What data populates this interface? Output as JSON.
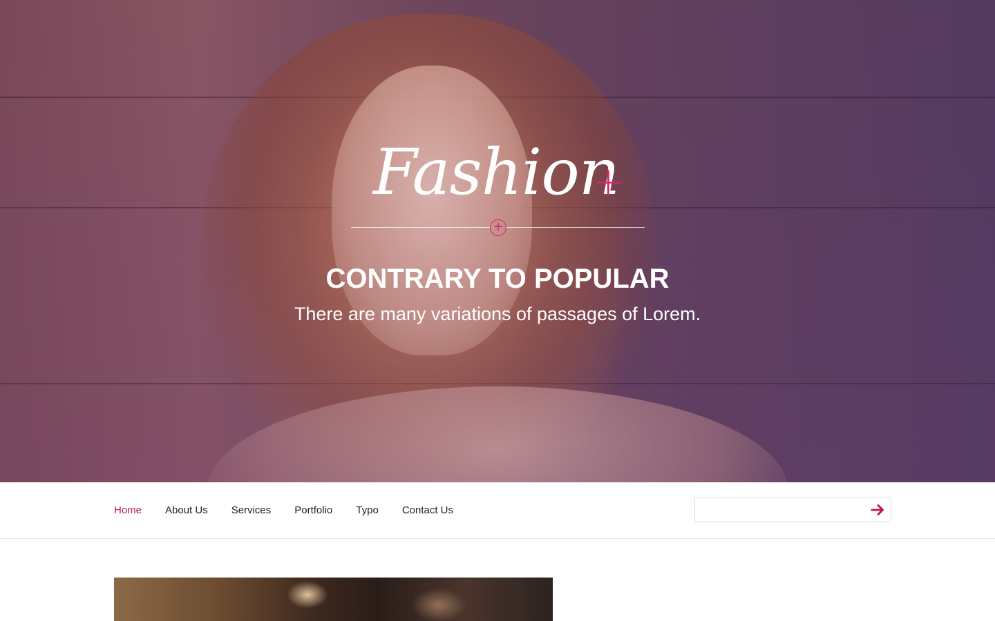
{
  "hero": {
    "logo_text": "Fashion",
    "logo_accent": "+",
    "divider_icon": "plus-circle-icon",
    "title": "CONTRARY TO POPULAR",
    "subtitle": "There are many variations of passages of Lorem."
  },
  "nav": {
    "items": [
      {
        "label": "Home",
        "active": true
      },
      {
        "label": "About Us",
        "active": false
      },
      {
        "label": "Services",
        "active": false
      },
      {
        "label": "Portfolio",
        "active": false
      },
      {
        "label": "Typo",
        "active": false
      },
      {
        "label": "Contact Us",
        "active": false
      }
    ]
  },
  "search": {
    "value": "",
    "placeholder": "",
    "button_icon": "arrow-right-icon"
  },
  "colors": {
    "accent": "#d6246e",
    "nav_active": "#c2185b",
    "nav_text": "#222222"
  }
}
